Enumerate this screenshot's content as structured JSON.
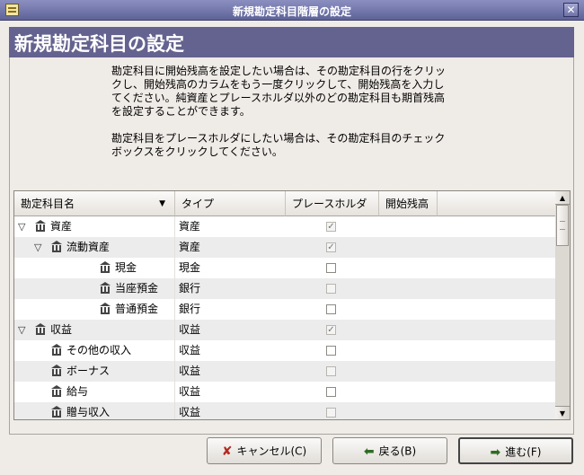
{
  "window": {
    "title": "新規勘定科目階層の設定",
    "close_glyph": "✕"
  },
  "page": {
    "heading": "新規勘定科目の設定",
    "paragraphs": [
      "勘定科目に開始残高を設定したい場合は、その勘定科目の行をクリッ\nクし、開始残高のカラムをもう一度クリックして、開始残高を入力し\nてください。純資産とプレースホルダ以外のどの勘定科目も期首残高\nを設定することができます。",
      "勘定科目をプレースホルダにしたい場合は、その勘定科目のチェック\nボックスをクリックしてください。"
    ]
  },
  "tree": {
    "columns": [
      "勘定科目名",
      "タイプ",
      "プレースホルダ",
      "開始残高"
    ],
    "rows": [
      {
        "name": "資産",
        "type": "資産",
        "level": 0,
        "expander": "▽",
        "placeholder": true,
        "enabled": false
      },
      {
        "name": "流動資産",
        "type": "資産",
        "level": 1,
        "expander": "▽",
        "placeholder": true,
        "enabled": false
      },
      {
        "name": "現金",
        "type": "現金",
        "level": 2,
        "expander": "",
        "placeholder": false,
        "enabled": true
      },
      {
        "name": "当座預金",
        "type": "銀行",
        "level": 2,
        "expander": "",
        "placeholder": false,
        "enabled": false
      },
      {
        "name": "普通預金",
        "type": "銀行",
        "level": 2,
        "expander": "",
        "placeholder": false,
        "enabled": true
      },
      {
        "name": "収益",
        "type": "収益",
        "level": 0,
        "expander": "▽",
        "placeholder": true,
        "enabled": false
      },
      {
        "name": "その他の収入",
        "type": "収益",
        "level": 1,
        "expander": "",
        "placeholder": false,
        "enabled": true
      },
      {
        "name": "ボーナス",
        "type": "収益",
        "level": 1,
        "expander": "",
        "placeholder": false,
        "enabled": false
      },
      {
        "name": "給与",
        "type": "収益",
        "level": 1,
        "expander": "",
        "placeholder": false,
        "enabled": true
      },
      {
        "name": "贈与収入",
        "type": "収益",
        "level": 1,
        "expander": "",
        "placeholder": false,
        "enabled": false
      }
    ]
  },
  "buttons": {
    "cancel": {
      "label": "キャンセル(C)",
      "icon": "x-icon"
    },
    "back": {
      "label": "戻る(B)",
      "icon": "arrow-left-icon"
    },
    "forward": {
      "label": "進む(F)",
      "icon": "arrow-right-icon"
    }
  },
  "colors": {
    "banner": "#64628f",
    "titlebar": "#6e72a6",
    "cancel_icon": "#b5291f",
    "arrow_icon": "#2f6b25"
  }
}
